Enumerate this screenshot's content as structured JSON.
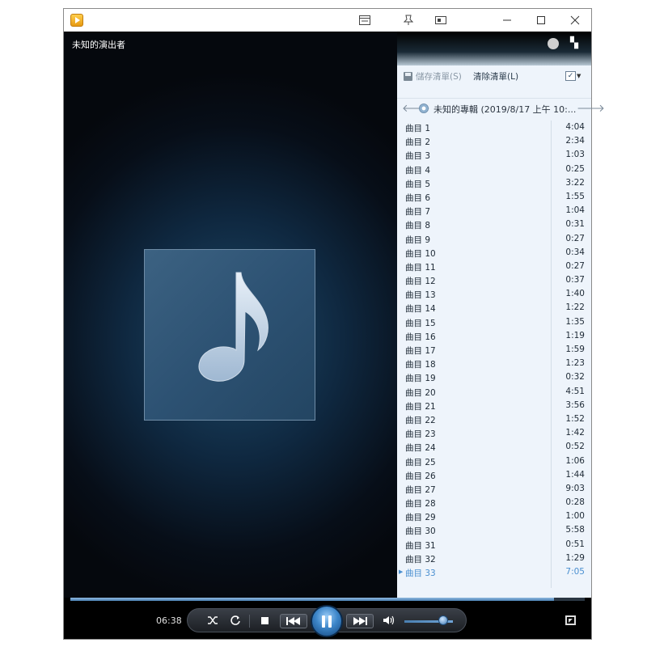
{
  "artist": "未知的演出者",
  "toolbar": {
    "save_label": "儲存清單(S)",
    "clear_label": "清除清單(L)"
  },
  "album": {
    "title": "未知的專輯 (2019/8/17 上午 10:..."
  },
  "tracks": [
    {
      "name": "曲目 1",
      "duration": "4:04"
    },
    {
      "name": "曲目 2",
      "duration": "2:34"
    },
    {
      "name": "曲目 3",
      "duration": "1:03"
    },
    {
      "name": "曲目 4",
      "duration": "0:25"
    },
    {
      "name": "曲目 5",
      "duration": "3:22"
    },
    {
      "name": "曲目 6",
      "duration": "1:55"
    },
    {
      "name": "曲目 7",
      "duration": "1:04"
    },
    {
      "name": "曲目 8",
      "duration": "0:31"
    },
    {
      "name": "曲目 9",
      "duration": "0:27"
    },
    {
      "name": "曲目 10",
      "duration": "0:34"
    },
    {
      "name": "曲目 11",
      "duration": "0:27"
    },
    {
      "name": "曲目 12",
      "duration": "0:37"
    },
    {
      "name": "曲目 13",
      "duration": "1:40"
    },
    {
      "name": "曲目 14",
      "duration": "1:22"
    },
    {
      "name": "曲目 15",
      "duration": "1:35"
    },
    {
      "name": "曲目 16",
      "duration": "1:19"
    },
    {
      "name": "曲目 17",
      "duration": "1:59"
    },
    {
      "name": "曲目 18",
      "duration": "1:23"
    },
    {
      "name": "曲目 19",
      "duration": "0:32"
    },
    {
      "name": "曲目 20",
      "duration": "4:51"
    },
    {
      "name": "曲目 21",
      "duration": "3:56"
    },
    {
      "name": "曲目 22",
      "duration": "1:52"
    },
    {
      "name": "曲目 23",
      "duration": "1:42"
    },
    {
      "name": "曲目 24",
      "duration": "0:52"
    },
    {
      "name": "曲目 25",
      "duration": "1:06"
    },
    {
      "name": "曲目 26",
      "duration": "1:44"
    },
    {
      "name": "曲目 27",
      "duration": "9:03"
    },
    {
      "name": "曲目 28",
      "duration": "0:28"
    },
    {
      "name": "曲目 29",
      "duration": "1:00"
    },
    {
      "name": "曲目 30",
      "duration": "5:58"
    },
    {
      "name": "曲目 31",
      "duration": "0:51"
    },
    {
      "name": "曲目 32",
      "duration": "1:29"
    },
    {
      "name": "曲目 33",
      "duration": "7:05",
      "playing": true
    }
  ],
  "playback": {
    "elapsed": "06:38",
    "progress_fraction": 0.94,
    "volume_fraction": 0.8
  },
  "colors": {
    "accent": "#4a8fd0",
    "list_background": "#eef4fb"
  },
  "icons": {
    "app": "media-player-icon",
    "art": "music-note-icon",
    "shuffle": "shuffle-icon",
    "repeat": "repeat-icon",
    "stop": "stop-icon",
    "previous": "previous-icon",
    "play_pause": "pause-icon",
    "next": "next-icon",
    "volume": "volume-icon",
    "fullscreen": "fullscreen-icon"
  }
}
